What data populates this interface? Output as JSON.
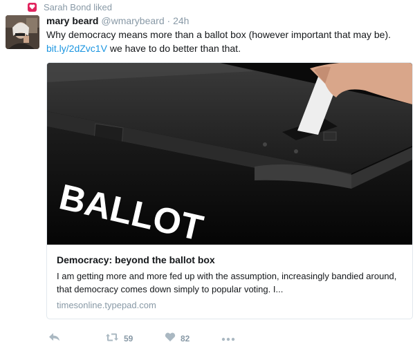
{
  "liked_banner": {
    "text": "Sarah Bond liked",
    "icon": "heart-icon",
    "color": "#e0245e"
  },
  "tweet": {
    "author_name": "mary beard",
    "handle": "@wmarybeard",
    "separator": "·",
    "time": "24h",
    "text_main": "Why democracy means more than a ballot box (however important that may be).",
    "link_text": "bit.ly/2dZvc1V",
    "text_after_link": " we have to do better than that."
  },
  "card": {
    "image_text": "BALLOT",
    "title": "Democracy: beyond the ballot box",
    "description": "I am getting more and more fed up with the assumption, increasingly bandied around, that democracy comes down simply to popular voting. I...",
    "domain": "timesonline.typepad.com"
  },
  "actions": {
    "reply_icon": "reply-icon",
    "retweet_icon": "retweet-icon",
    "retweet_count": "59",
    "like_icon": "heart-icon",
    "like_count": "82",
    "more_icon": "more-icon"
  },
  "colors": {
    "link": "#1b95e0",
    "muted": "#8899a6",
    "like": "#e0245e"
  }
}
